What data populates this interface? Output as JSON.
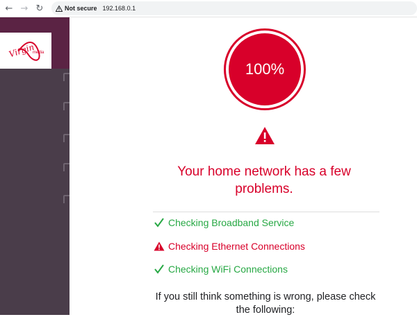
{
  "browser": {
    "security_label": "Not secure",
    "url": "192.168.0.1",
    "icons": [
      "back-icon",
      "forward-icon",
      "reload-icon",
      "warning-icon"
    ]
  },
  "logo": {
    "brand": "Virgin media"
  },
  "progress": {
    "label": "100%",
    "value": 100
  },
  "status": {
    "headline": "Your home network has a few problems."
  },
  "checks": [
    {
      "label": "Checking Broadband Service",
      "state": "ok",
      "color": "#27a844"
    },
    {
      "label": "Checking Ethernet Connections",
      "state": "problem",
      "color": "#d8002a"
    },
    {
      "label": "Checking WiFi Connections",
      "state": "ok",
      "color": "#27a844"
    }
  ],
  "footer_text": "If you still think something is wrong, please check the following:",
  "colors": {
    "accent": "#d8002a",
    "success": "#27a844",
    "sidebar": "#4a3d4a"
  }
}
